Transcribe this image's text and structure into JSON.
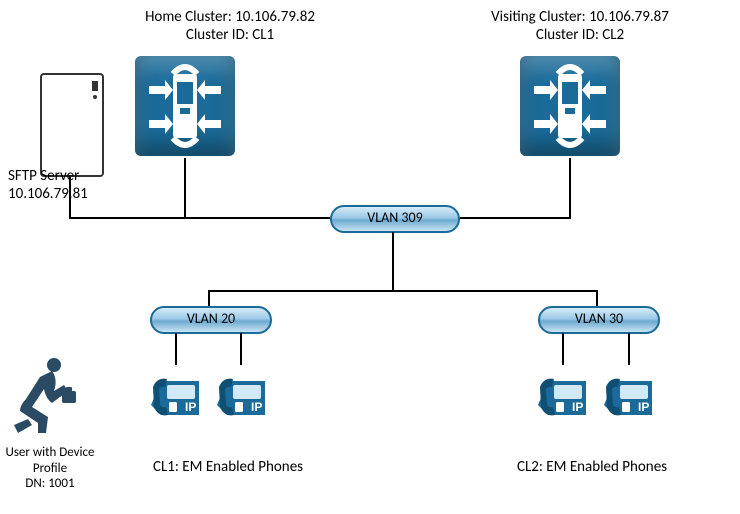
{
  "homeCluster": {
    "title": "Home Cluster: 10.106.79.82",
    "id": "Cluster ID: CL1"
  },
  "visitingCluster": {
    "title": "Visiting Cluster: 10.106.79.87",
    "id": "Cluster ID: CL2"
  },
  "sftpServer": {
    "label": "SFTP Server",
    "ip": "10.106.79.81"
  },
  "vlan": {
    "center": "VLAN 309",
    "left": "VLAN 20",
    "right": "VLAN 30"
  },
  "phoneGroups": {
    "left": "CL1: EM Enabled Phones",
    "right": "CL2: EM Enabled Phones"
  },
  "user": {
    "line1": "User with Device",
    "line2": "Profile",
    "line3": "DN: 1001"
  }
}
